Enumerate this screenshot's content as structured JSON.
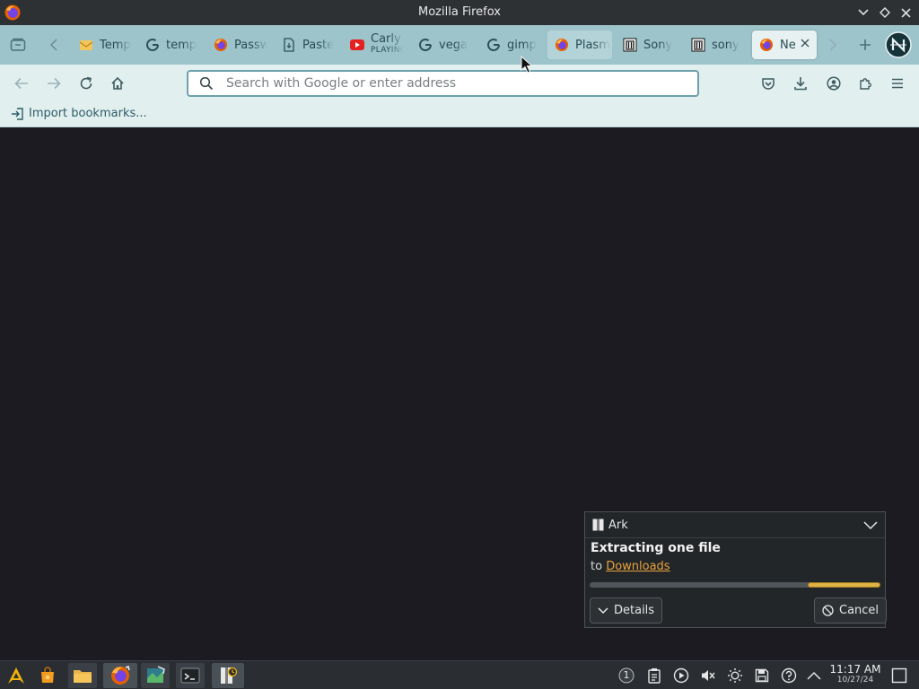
{
  "window": {
    "title": "Mozilla Firefox"
  },
  "tabs": [
    {
      "label": "Temp",
      "icon": "mail-icon"
    },
    {
      "label": "temp",
      "icon": "google-icon"
    },
    {
      "label": "Passw",
      "icon": "firefox-icon"
    },
    {
      "label": "Paste",
      "icon": "document-icon"
    },
    {
      "label": "Carly",
      "sub": "PLAYING",
      "icon": "youtube-icon"
    },
    {
      "label": "vega",
      "icon": "google-icon"
    },
    {
      "label": "gimp",
      "icon": "google-icon"
    },
    {
      "label": "Plasm",
      "icon": "firefox-icon"
    },
    {
      "label": "Sony",
      "icon": "archive-icon"
    },
    {
      "label": "sony",
      "icon": "archive-icon"
    },
    {
      "label": "Ne",
      "icon": "firefox-icon",
      "active": true
    }
  ],
  "urlbar": {
    "placeholder": "Search with Google or enter address",
    "value": ""
  },
  "bookmarks": {
    "import_label": "Import bookmarks..."
  },
  "notification": {
    "app": "Ark",
    "title": "Extracting one file",
    "body_prefix": "to ",
    "body_link": "Downloads",
    "progress": 0.25,
    "details_label": "Details",
    "cancel_label": "Cancel"
  },
  "taskbar": {
    "pager_badge": "1",
    "clock_time": "11:17 AM",
    "clock_date": "10/27/24"
  },
  "colors": {
    "tabstrip": "#9dc4cb",
    "toolbar": "#e2efef",
    "content": "#1c1b22",
    "accent": "#e0b347",
    "link": "#e9a23b"
  }
}
